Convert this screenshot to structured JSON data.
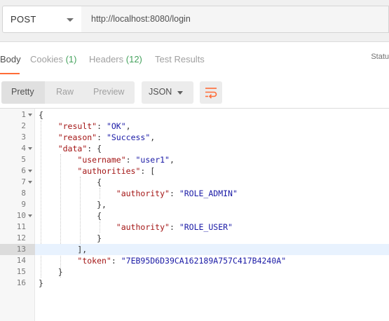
{
  "request": {
    "method": "POST",
    "url": "http://localhost:8080/login"
  },
  "tabs": {
    "body": "Body",
    "cookies": "Cookies",
    "cookies_count": "(1)",
    "headers": "Headers",
    "headers_count": "(12)",
    "test_results": "Test Results",
    "status": "Statu"
  },
  "toolbar": {
    "pretty": "Pretty",
    "raw": "Raw",
    "preview": "Preview",
    "format": "JSON",
    "wrap_icon": "wrap-lines-icon"
  },
  "code": {
    "active_line": 13,
    "lines": [
      {
        "n": "1",
        "fold": true,
        "tokens": [
          [
            "p",
            "{"
          ]
        ]
      },
      {
        "n": "2",
        "tokens": [
          [
            "p",
            "    "
          ],
          [
            "k",
            "\"result\""
          ],
          [
            "p",
            ": "
          ],
          [
            "s",
            "\"OK\""
          ],
          [
            "p",
            ","
          ]
        ]
      },
      {
        "n": "3",
        "tokens": [
          [
            "p",
            "    "
          ],
          [
            "k",
            "\"reason\""
          ],
          [
            "p",
            ": "
          ],
          [
            "s",
            "\"Success\""
          ],
          [
            "p",
            ","
          ]
        ]
      },
      {
        "n": "4",
        "fold": true,
        "tokens": [
          [
            "p",
            "    "
          ],
          [
            "k",
            "\"data\""
          ],
          [
            "p",
            ": {"
          ]
        ]
      },
      {
        "n": "5",
        "tokens": [
          [
            "p",
            "        "
          ],
          [
            "k",
            "\"username\""
          ],
          [
            "p",
            ": "
          ],
          [
            "s",
            "\"user1\""
          ],
          [
            "p",
            ","
          ]
        ]
      },
      {
        "n": "6",
        "fold": true,
        "tokens": [
          [
            "p",
            "        "
          ],
          [
            "k",
            "\"authorities\""
          ],
          [
            "p",
            ": ["
          ]
        ]
      },
      {
        "n": "7",
        "fold": true,
        "tokens": [
          [
            "p",
            "            {"
          ]
        ]
      },
      {
        "n": "8",
        "tokens": [
          [
            "p",
            "                "
          ],
          [
            "k",
            "\"authority\""
          ],
          [
            "p",
            ": "
          ],
          [
            "s",
            "\"ROLE_ADMIN\""
          ]
        ]
      },
      {
        "n": "9",
        "tokens": [
          [
            "p",
            "            },"
          ]
        ]
      },
      {
        "n": "10",
        "fold": true,
        "tokens": [
          [
            "p",
            "            {"
          ]
        ]
      },
      {
        "n": "11",
        "tokens": [
          [
            "p",
            "                "
          ],
          [
            "k",
            "\"authority\""
          ],
          [
            "p",
            ": "
          ],
          [
            "s",
            "\"ROLE_USER\""
          ]
        ]
      },
      {
        "n": "12",
        "tokens": [
          [
            "p",
            "            }"
          ]
        ]
      },
      {
        "n": "13",
        "tokens": [
          [
            "p",
            "        ],"
          ]
        ]
      },
      {
        "n": "14",
        "tokens": [
          [
            "p",
            "        "
          ],
          [
            "k",
            "\"token\""
          ],
          [
            "p",
            ": "
          ],
          [
            "s",
            "\"7EB95D6D39CA162189A757C417B4240A\""
          ]
        ]
      },
      {
        "n": "15",
        "tokens": [
          [
            "p",
            "    }"
          ]
        ]
      },
      {
        "n": "16",
        "tokens": [
          [
            "p",
            "}"
          ]
        ]
      }
    ]
  },
  "colors": {
    "accent": "#ff6c37",
    "count": "#46a35e",
    "json_key": "#a31515",
    "json_string": "#1a1aa6"
  }
}
